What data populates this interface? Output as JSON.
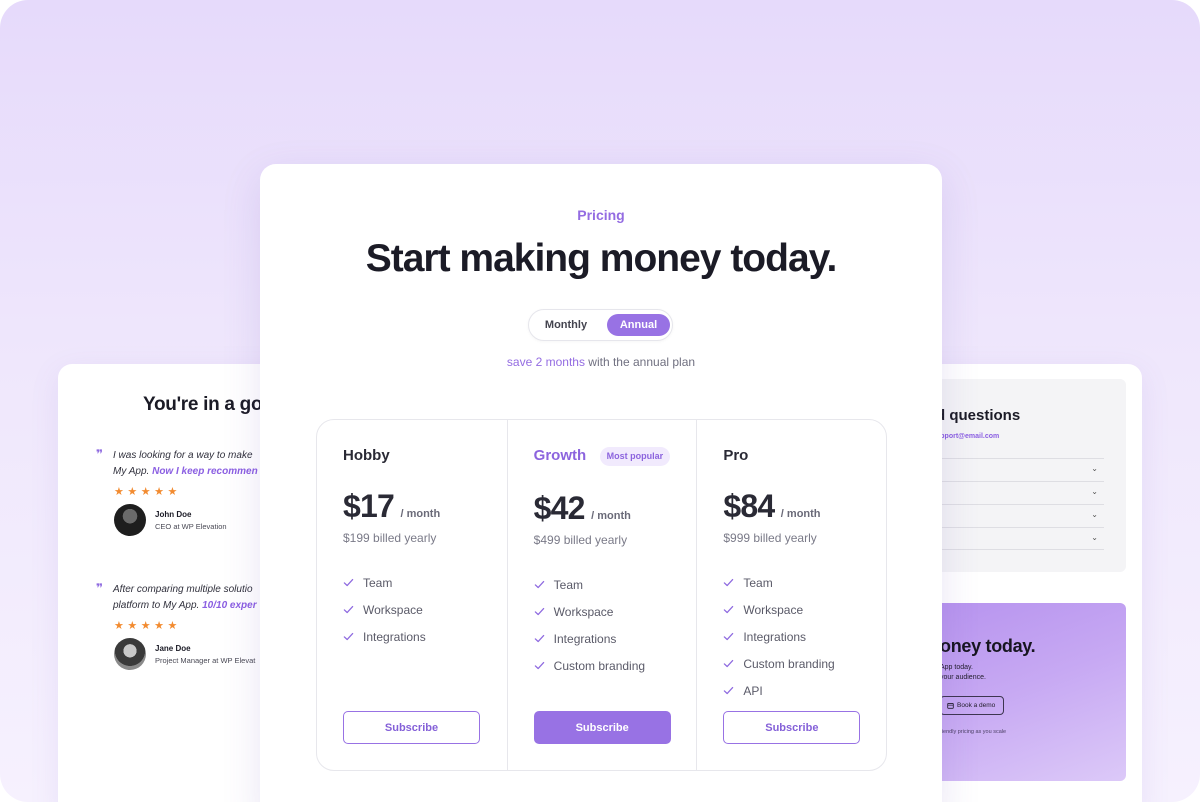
{
  "testimonials": {
    "title": "You're in a go",
    "items": [
      {
        "line1": "I was looking for a way to make",
        "line2_plain": "My App. ",
        "line2_highlight": "Now I keep recommen",
        "stars": "★★★★★",
        "name": "John Doe",
        "role": "CEO at WP Elevation"
      },
      {
        "line1": "After comparing multiple solutio",
        "line2_plain": "platform to My App. ",
        "line2_highlight": "10/10 exper",
        "stars": "★★★★★",
        "name": "Jane Doe",
        "role": "Project Manager at WP Elevat"
      }
    ]
  },
  "faq": {
    "title": "d questions",
    "email": "upport@email.com",
    "rows": [
      "",
      "",
      "",
      ""
    ]
  },
  "cta": {
    "title": "oney today.",
    "line1": "App today.",
    "line2": "your audience.",
    "button": "Book a demo",
    "note": "riendly pricing as you scale"
  },
  "pricing": {
    "eyebrow": "Pricing",
    "headline": "Start making money today.",
    "toggle": {
      "monthly": "Monthly",
      "annual": "Annual",
      "selected": "Annual"
    },
    "save_highlight": "save 2 months",
    "save_rest": " with the annual plan",
    "plans": [
      {
        "name": "Hobby",
        "badge": "",
        "price": "$17",
        "period": "/ month",
        "billed": "$199 billed yearly",
        "features": [
          "Team",
          "Workspace",
          "Integrations"
        ],
        "button": "Subscribe"
      },
      {
        "name": "Growth",
        "badge": "Most popular",
        "price": "$42",
        "period": "/ month",
        "billed": "$499 billed yearly",
        "features": [
          "Team",
          "Workspace",
          "Integrations",
          "Custom branding"
        ],
        "button": "Subscribe"
      },
      {
        "name": "Pro",
        "badge": "",
        "price": "$84",
        "period": "/ month",
        "billed": "$999 billed yearly",
        "features": [
          "Team",
          "Workspace",
          "Integrations",
          "Custom branding",
          "API"
        ],
        "button": "Subscribe"
      }
    ]
  },
  "colors": {
    "accent": "#9872e4",
    "accent_text": "#946ce2",
    "star": "#f28b30",
    "background_top": "#e6dafb"
  },
  "icons": {
    "check": "check-icon",
    "quote": "quote-icon",
    "chevron": "chevron-down-icon",
    "calendar": "calendar-icon"
  }
}
